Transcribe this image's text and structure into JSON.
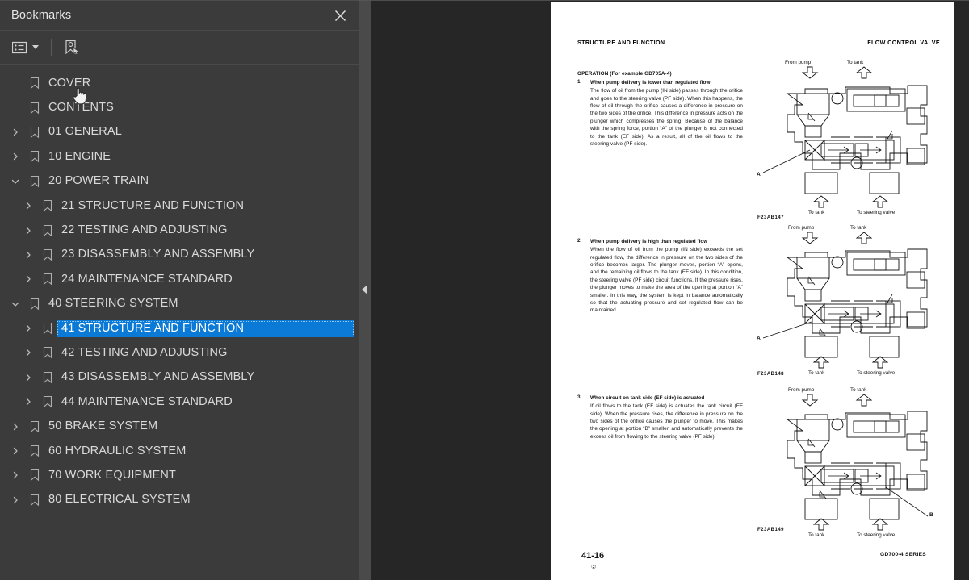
{
  "panel": {
    "title": "Bookmarks",
    "close_icon": "close-icon",
    "toolbar": {
      "options_icon": "list-options-icon",
      "new_bookmark_icon": "new-bookmark-icon"
    }
  },
  "tree": {
    "items": [
      {
        "label": "COVER",
        "level": 0,
        "twisty": "none",
        "bookmark": true,
        "selected": false,
        "underline": false
      },
      {
        "label": "CONTENTS",
        "level": 0,
        "twisty": "none",
        "bookmark": true,
        "selected": false,
        "underline": false
      },
      {
        "label": "01 GENERAL",
        "level": 0,
        "twisty": "collapsed",
        "bookmark": true,
        "selected": false,
        "underline": true
      },
      {
        "label": "10 ENGINE",
        "level": 0,
        "twisty": "collapsed",
        "bookmark": true,
        "selected": false,
        "underline": false
      },
      {
        "label": "20 POWER TRAIN",
        "level": 0,
        "twisty": "expanded",
        "bookmark": true,
        "selected": false,
        "underline": false
      },
      {
        "label": "21 STRUCTURE AND FUNCTION",
        "level": 1,
        "twisty": "collapsed",
        "bookmark": true,
        "selected": false,
        "underline": false
      },
      {
        "label": "22 TESTING AND ADJUSTING",
        "level": 1,
        "twisty": "collapsed",
        "bookmark": true,
        "selected": false,
        "underline": false
      },
      {
        "label": "23 DISASSEMBLY AND ASSEMBLY",
        "level": 1,
        "twisty": "collapsed",
        "bookmark": true,
        "selected": false,
        "underline": false
      },
      {
        "label": "24 MAINTENANCE STANDARD",
        "level": 1,
        "twisty": "collapsed",
        "bookmark": true,
        "selected": false,
        "underline": false
      },
      {
        "label": "40 STEERING SYSTEM",
        "level": 0,
        "twisty": "expanded",
        "bookmark": true,
        "selected": false,
        "underline": false
      },
      {
        "label": "41 STRUCTURE AND FUNCTION",
        "level": 1,
        "twisty": "collapsed",
        "bookmark": true,
        "selected": true,
        "underline": false
      },
      {
        "label": "42 TESTING AND ADJUSTING",
        "level": 1,
        "twisty": "collapsed",
        "bookmark": true,
        "selected": false,
        "underline": false
      },
      {
        "label": "43 DISASSEMBLY AND ASSEMBLY",
        "level": 1,
        "twisty": "collapsed",
        "bookmark": true,
        "selected": false,
        "underline": false
      },
      {
        "label": "44 MAINTENANCE STANDARD",
        "level": 1,
        "twisty": "collapsed",
        "bookmark": true,
        "selected": false,
        "underline": false
      },
      {
        "label": "50 BRAKE SYSTEM",
        "level": 0,
        "twisty": "collapsed",
        "bookmark": true,
        "selected": false,
        "underline": false
      },
      {
        "label": "60 HYDRAULIC SYSTEM",
        "level": 0,
        "twisty": "collapsed",
        "bookmark": true,
        "selected": false,
        "underline": false
      },
      {
        "label": "70 WORK EQUIPMENT",
        "level": 0,
        "twisty": "collapsed",
        "bookmark": true,
        "selected": false,
        "underline": false
      },
      {
        "label": "80 ELECTRICAL SYSTEM",
        "level": 0,
        "twisty": "collapsed",
        "bookmark": true,
        "selected": false,
        "underline": false
      }
    ]
  },
  "splitter": {
    "collapse_icon": "collapse-left-icon"
  },
  "document": {
    "header_left": "STRUCTURE AND FUNCTION",
    "header_right": "FLOW CONTROL VALVE",
    "operation_title": "OPERATION (For example GD705A-4)",
    "items": [
      {
        "num": "1.",
        "heading": "When pump delivery is lower than regulated flow",
        "body": "The flow of oil from the pump (IN side) passes through the orifice and goes to the steering valve (PF side). When this happens, the flow of oil through the orifice causes a difference in pressure on the two sides of the orifice. This difference in pressure acts on the plunger which compresses the spring. Because of the balance with the spring force, portion “A” of the plunger is not connected to the tank (EF side). As a result, all of the oil flows to the steering valve (PF side)."
      },
      {
        "num": "2.",
        "heading": "When pump delivery is high than regulated flow",
        "body": "When the flow of oil from the pump (IN side) exceeds the set regulated flow, the difference in pressure on the two sides of the orifice becomes larger. The plunger moves, portion “A” opens, and the remaining oil flows to the tank (EF side). In this condition, the steering valve (PF side) circuit functions. If the pressure rises, the plunger moves to make the area of the opening at portion “A” smaller. In this way, the system is kept in balance automatically so that the actuating pressure and set regulated flow can be maintained."
      },
      {
        "num": "3.",
        "heading": "When circuit on tank side (EF side) is actuated",
        "body": "If oil flows to the tank (EF side) is actuates the tank circuit (EF side). When the pressure rises, the difference in pressure on the two sides of the orifice causes the plunger to move. This makes the opening at portion “B” smaller, and automatically prevents the excess oil from flowing to the steering valve (PF side)."
      }
    ],
    "figures": [
      {
        "id": "F23AB147",
        "top_labels": [
          "From pump",
          "To tank"
        ],
        "bottom_labels": [
          "To tank",
          "To steering valve"
        ],
        "callout": "A"
      },
      {
        "id": "F23AB148",
        "top_labels": [
          "From pump",
          "To tank"
        ],
        "bottom_labels": [
          "To tank",
          "To steering valve"
        ],
        "callout": "A"
      },
      {
        "id": "F23AB149",
        "top_labels": [
          "From pump",
          "To tank"
        ],
        "bottom_labels": [
          "To tank",
          "To steering valve"
        ],
        "callout": "B"
      }
    ],
    "footer": {
      "page_number": "41-16",
      "revision": "②",
      "series": "GD700-4 SERIES"
    }
  },
  "colors": {
    "panel_bg": "#3b3b3b",
    "viewer_bg": "#262626",
    "selection_blue": "#0b7ad6",
    "splitter": "#4a4a4a"
  }
}
